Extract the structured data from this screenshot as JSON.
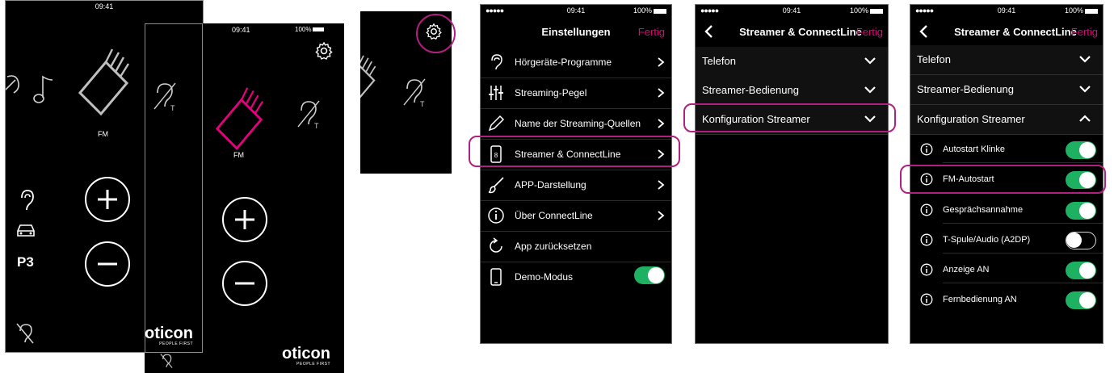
{
  "colors": {
    "accent": "#e6007e",
    "highlight": "#b0207f",
    "toggle_on": "#1eb162",
    "background": "#000000"
  },
  "status_bar": {
    "signal": "●●●●● ",
    "time": "09:41",
    "battery": "100%"
  },
  "brand": {
    "logo": "oticon",
    "tagline": "PEOPLE FIRST"
  },
  "screen1": {
    "program_label": "FM",
    "program_number": "P3",
    "icons": [
      "ear-icon",
      "music-note-icon",
      "fm-hand-icon",
      "car-icon",
      "ear-muted-icon"
    ]
  },
  "screen2": {
    "program_label": "FM",
    "icons": [
      "telecoil-icon",
      "fm-hand-icon-active",
      "telecoil-icon"
    ]
  },
  "settings": {
    "title": "Einstellungen",
    "done": "Fertig",
    "items": [
      {
        "label": "Hörgeräte-Programme",
        "icon": "ear-icon"
      },
      {
        "label": "Streaming-Pegel",
        "icon": "equalizer-icon"
      },
      {
        "label": "Name der Streaming-Quellen",
        "icon": "pencil-icon"
      },
      {
        "label": "Streamer & ConnectLine",
        "icon": "streamer-icon"
      },
      {
        "label": "APP-Darstellung",
        "icon": "brush-icon"
      },
      {
        "label": "Über ConnectLine",
        "icon": "info-icon"
      },
      {
        "label": "App zurücksetzen",
        "icon": "reset-icon"
      },
      {
        "label": "Demo-Modus",
        "icon": "phone-icon",
        "toggle": true
      }
    ]
  },
  "streamer_screen": {
    "title": "Streamer & ConnectLine",
    "done": "Fertig",
    "sections": [
      {
        "label": "Telefon"
      },
      {
        "label": "Streamer-Bedienung"
      },
      {
        "label": "Konfiguration Streamer"
      }
    ]
  },
  "streamer_expanded": {
    "title": "Streamer & ConnectLine",
    "done": "Fertig",
    "sections": [
      {
        "label": "Telefon"
      },
      {
        "label": "Streamer-Bedienung"
      },
      {
        "label": "Konfiguration Streamer"
      }
    ],
    "options": [
      {
        "label": "Autostart Klinke",
        "on": true
      },
      {
        "label": "FM-Autostart",
        "on": true
      },
      {
        "label": "Gesprächsannahme",
        "on": true
      },
      {
        "label": "T-Spule/Audio (A2DP)",
        "on": false
      },
      {
        "label": "Anzeige AN",
        "on": true
      },
      {
        "label": "Fernbedienung AN",
        "on": true
      }
    ]
  }
}
